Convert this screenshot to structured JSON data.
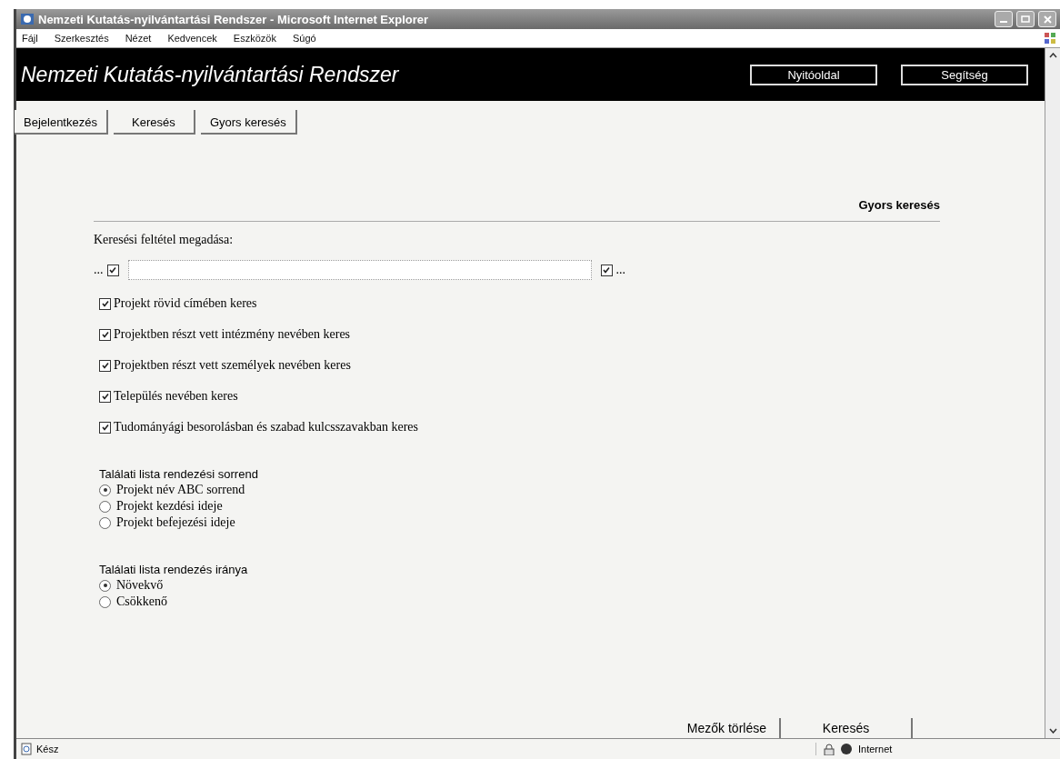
{
  "window": {
    "title": "Nemzeti Kutatás-nyilvántartási Rendszer - Microsoft Internet Explorer"
  },
  "menu": [
    "Fájl",
    "Szerkesztés",
    "Nézet",
    "Kedvencek",
    "Eszközök",
    "Súgó"
  ],
  "header": {
    "title": "Nemzeti Kutatás-nyilvántartási Rendszer",
    "buttons": [
      "Nyitóoldal",
      "Segítség"
    ]
  },
  "nav_tabs": [
    "Bejelentkezés",
    "Keresés",
    "Gyors keresés"
  ],
  "section_title": "Gyors keresés",
  "criteria_label": "Keresési feltétel megadása:",
  "search_row": {
    "prefix": "...",
    "left_checked": true,
    "right_checked": true,
    "suffix": "..."
  },
  "options": [
    {
      "label": "Projekt rövid címében keres",
      "checked": true
    },
    {
      "label": "Projektben részt vett intézmény nevében keres",
      "checked": true
    },
    {
      "label": "Projektben részt vett személyek nevében keres",
      "checked": true
    },
    {
      "label": "Település nevében keres",
      "checked": true
    },
    {
      "label": "Tudományági besorolásban és szabad kulcsszavakban keres",
      "checked": true
    }
  ],
  "sort_order": {
    "label": "Találati lista rendezési sorrend",
    "options": [
      {
        "label": "Projekt név ABC sorrend",
        "selected": true
      },
      {
        "label": "Projekt kezdési ideje",
        "selected": false
      },
      {
        "label": "Projekt befejezési ideje",
        "selected": false
      }
    ]
  },
  "sort_direction": {
    "label": "Találati lista rendezés iránya",
    "options": [
      {
        "label": "Növekvő",
        "selected": true
      },
      {
        "label": "Csökkenő",
        "selected": false
      }
    ]
  },
  "actions": [
    "Mezők törlése",
    "Keresés"
  ],
  "status_bar": {
    "text": "Kész",
    "zone": "Internet"
  }
}
